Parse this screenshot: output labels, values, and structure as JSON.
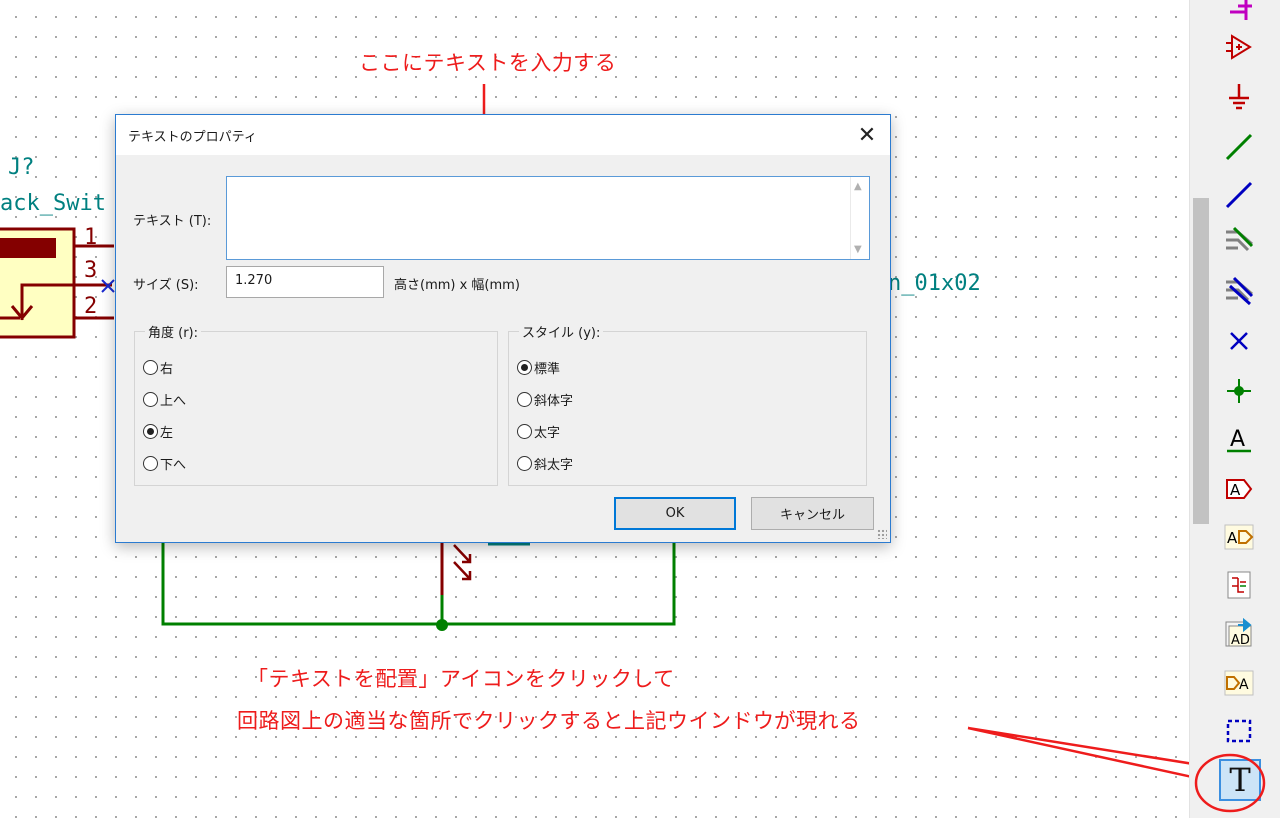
{
  "schematic": {
    "ref": "J?",
    "value": "ack_Swit",
    "pin1": "1",
    "pin3": "3",
    "pin2": "2",
    "conn_value": "n_01x02",
    "wire_color": "#008000",
    "component_color": "#840000",
    "label_color": "#008080"
  },
  "annotations": {
    "top": "ここにテキストを入力する",
    "bottom_line1": "「テキストを配置」アイコンをクリックして",
    "bottom_line2": "回路図上の適当な箇所でクリックすると上記ウインドウが現れる",
    "color": "#ee1c1c"
  },
  "dialog": {
    "title": "テキストのプロパティ",
    "close_glyph": "✕",
    "text_label": "テキスト (T):",
    "text_value": "",
    "size_label": "サイズ (S):",
    "size_value": "1.270",
    "size_unit": "高さ(mm) x 幅(mm)",
    "angle": {
      "title": "角度 (r):",
      "options": [
        "右",
        "上へ",
        "左",
        "下へ"
      ],
      "selected": "左"
    },
    "style": {
      "title": "スタイル (y):",
      "options": [
        "標準",
        "斜体字",
        "太字",
        "斜太字"
      ],
      "selected": "標準"
    },
    "ok_label": "OK",
    "cancel_label": "キャンセル"
  },
  "toolbar": {
    "tools": [
      {
        "name": "hierarchical-pin-icon"
      },
      {
        "name": "add-power-icon"
      },
      {
        "name": "ground-symbol-icon"
      },
      {
        "name": "wire-icon"
      },
      {
        "name": "bus-icon"
      },
      {
        "name": "wire-to-bus-entry-icon"
      },
      {
        "name": "bus-to-bus-entry-icon"
      },
      {
        "name": "no-connect-icon"
      },
      {
        "name": "junction-icon"
      },
      {
        "name": "net-label-icon"
      },
      {
        "name": "global-label-icon"
      },
      {
        "name": "hierarchical-label-icon"
      },
      {
        "name": "hierarchical-sheet-icon"
      },
      {
        "name": "import-sheet-pin-icon"
      },
      {
        "name": "hierarchical-pin-sheet-icon"
      },
      {
        "name": "graphic-line-icon"
      },
      {
        "name": "place-text-icon",
        "label": "T",
        "active": true
      }
    ]
  }
}
